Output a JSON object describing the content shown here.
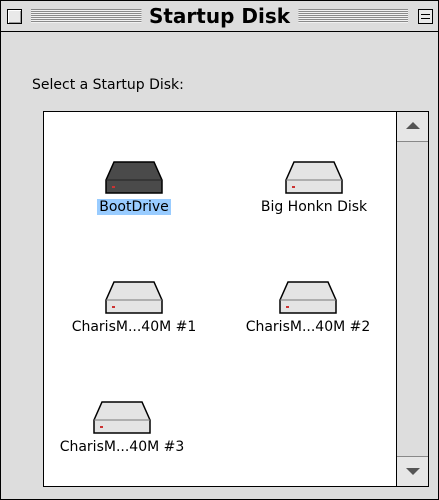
{
  "window": {
    "title": "Startup Disk"
  },
  "prompt": "Select a Startup Disk:",
  "disks": [
    {
      "label": "BootDrive",
      "selected": true
    },
    {
      "label": "Big Honkn Disk",
      "selected": false
    },
    {
      "label": "CharisM...40M #1",
      "selected": false
    },
    {
      "label": "CharisM...40M #2",
      "selected": false
    },
    {
      "label": "CharisM...40M #3",
      "selected": false
    }
  ],
  "colors": {
    "selection": "#99ccff",
    "chrome": "#dddddd",
    "led": "#cc3333"
  }
}
